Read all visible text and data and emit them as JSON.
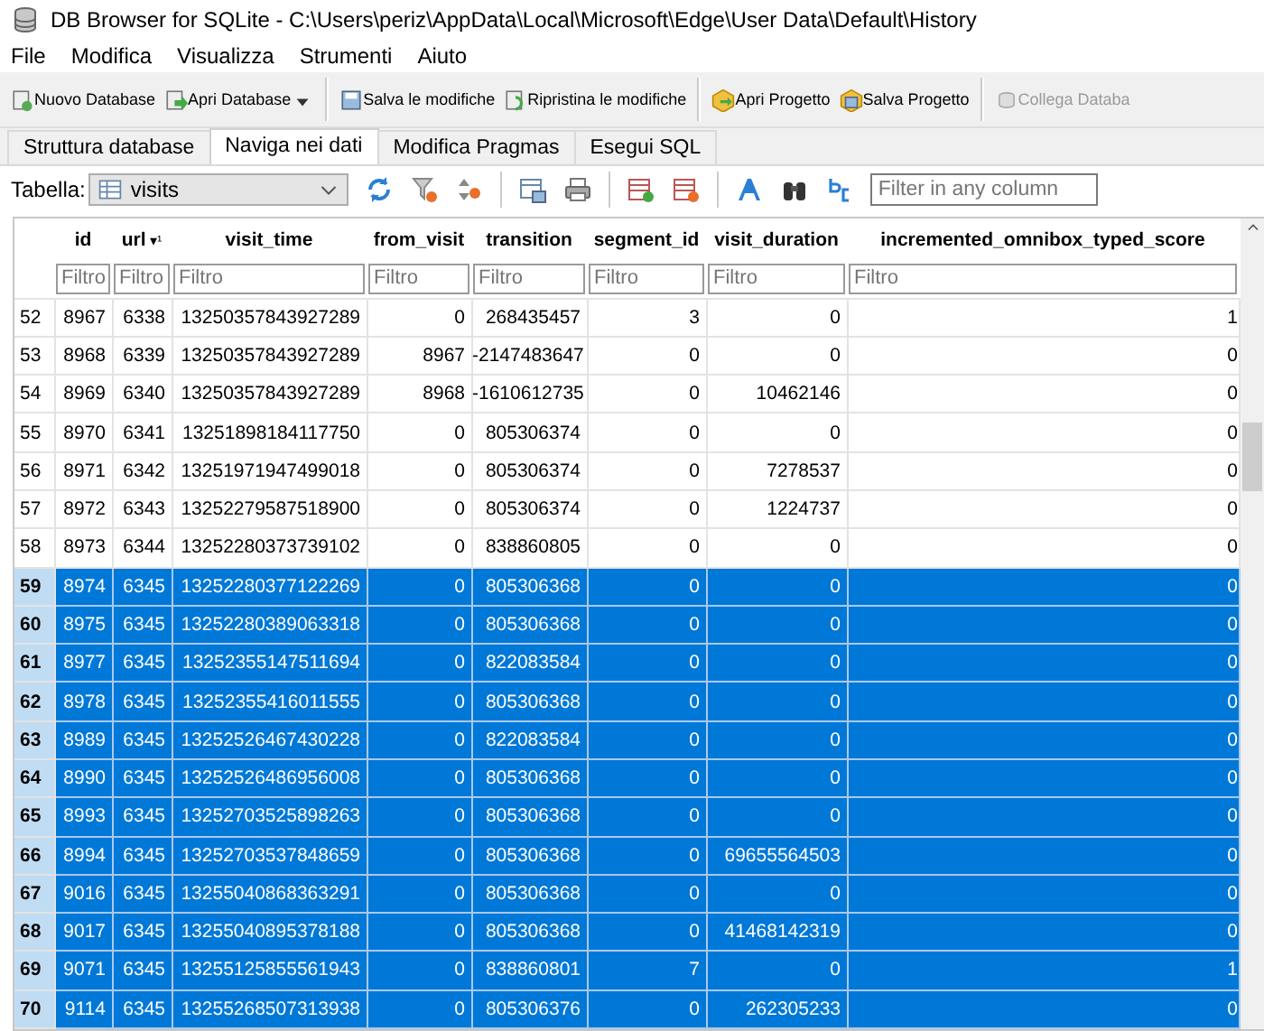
{
  "window": {
    "title": "DB Browser for SQLite - C:\\Users\\periz\\AppData\\Local\\Microsoft\\Edge\\User Data\\Default\\History"
  },
  "menu": [
    {
      "label": "File"
    },
    {
      "label": "Modifica"
    },
    {
      "label": "Visualizza"
    },
    {
      "label": "Strumenti"
    },
    {
      "label": "Aiuto"
    }
  ],
  "toolbar": [
    {
      "label": "Nuovo Database",
      "disabled": false
    },
    {
      "label": "Apri Database",
      "disabled": false
    },
    {
      "label": "Salva le modifiche",
      "disabled": false
    },
    {
      "label": "Ripristina le modifiche",
      "disabled": false
    },
    {
      "label": "Apri Progetto",
      "disabled": false
    },
    {
      "label": "Salva Progetto",
      "disabled": false
    },
    {
      "label": "Collega Databa",
      "disabled": true
    }
  ],
  "tabs": [
    {
      "label": "Struttura database",
      "selected": false
    },
    {
      "label": "Naviga nei dati",
      "selected": true
    },
    {
      "label": "Modifica Pragmas",
      "selected": false
    },
    {
      "label": "Esegui SQL",
      "selected": false
    }
  ],
  "table_picker": {
    "label": "Tabella:",
    "value": "visits"
  },
  "search": {
    "placeholder": "Filter in any column"
  },
  "table": {
    "columns": [
      {
        "name": "id",
        "filter_placeholder": "Filtro"
      },
      {
        "name": "url",
        "sort": "▾¹",
        "filter_placeholder": "Filtro"
      },
      {
        "name": "visit_time",
        "filter_placeholder": "Filtro"
      },
      {
        "name": "from_visit",
        "filter_placeholder": "Filtro"
      },
      {
        "name": "transition",
        "filter_placeholder": "Filtro"
      },
      {
        "name": "segment_id",
        "filter_placeholder": "Filtro"
      },
      {
        "name": "visit_duration",
        "filter_placeholder": "Filtro"
      },
      {
        "name": "incremented_omnibox_typed_score",
        "filter_placeholder": "Filtro"
      }
    ],
    "rows": [
      {
        "num": "52",
        "selected": false,
        "cells": [
          "8967",
          "6338",
          "13250357843927289",
          "0",
          "268435457",
          "3",
          "0",
          "1"
        ]
      },
      {
        "num": "53",
        "selected": false,
        "cells": [
          "8968",
          "6339",
          "13250357843927289",
          "8967",
          "-2147483647",
          "0",
          "0",
          "0"
        ]
      },
      {
        "num": "54",
        "selected": false,
        "cells": [
          "8969",
          "6340",
          "13250357843927289",
          "8968",
          "-1610612735",
          "0",
          "10462146",
          "0"
        ]
      },
      {
        "num": "55",
        "selected": false,
        "cells": [
          "8970",
          "6341",
          "13251898184117750",
          "0",
          "805306374",
          "0",
          "0",
          "0"
        ]
      },
      {
        "num": "56",
        "selected": false,
        "cells": [
          "8971",
          "6342",
          "13251971947499018",
          "0",
          "805306374",
          "0",
          "7278537",
          "0"
        ]
      },
      {
        "num": "57",
        "selected": false,
        "cells": [
          "8972",
          "6343",
          "13252279587518900",
          "0",
          "805306374",
          "0",
          "1224737",
          "0"
        ]
      },
      {
        "num": "58",
        "selected": false,
        "cells": [
          "8973",
          "6344",
          "13252280373739102",
          "0",
          "838860805",
          "0",
          "0",
          "0"
        ]
      },
      {
        "num": "59",
        "selected": true,
        "cells": [
          "8974",
          "6345",
          "13252280377122269",
          "0",
          "805306368",
          "0",
          "0",
          "0"
        ]
      },
      {
        "num": "60",
        "selected": true,
        "cells": [
          "8975",
          "6345",
          "13252280389063318",
          "0",
          "805306368",
          "0",
          "0",
          "0"
        ]
      },
      {
        "num": "61",
        "selected": true,
        "cells": [
          "8977",
          "6345",
          "13252355147511694",
          "0",
          "822083584",
          "0",
          "0",
          "0"
        ]
      },
      {
        "num": "62",
        "selected": true,
        "cells": [
          "8978",
          "6345",
          "13252355416011555",
          "0",
          "805306368",
          "0",
          "0",
          "0"
        ]
      },
      {
        "num": "63",
        "selected": true,
        "cells": [
          "8989",
          "6345",
          "13252526467430228",
          "0",
          "822083584",
          "0",
          "0",
          "0"
        ]
      },
      {
        "num": "64",
        "selected": true,
        "cells": [
          "8990",
          "6345",
          "13252526486956008",
          "0",
          "805306368",
          "0",
          "0",
          "0"
        ]
      },
      {
        "num": "65",
        "selected": true,
        "cells": [
          "8993",
          "6345",
          "13252703525898263",
          "0",
          "805306368",
          "0",
          "0",
          "0"
        ]
      },
      {
        "num": "66",
        "selected": true,
        "cells": [
          "8994",
          "6345",
          "13252703537848659",
          "0",
          "805306368",
          "0",
          "69655564503",
          "0"
        ]
      },
      {
        "num": "67",
        "selected": true,
        "cells": [
          "9016",
          "6345",
          "13255040868363291",
          "0",
          "805306368",
          "0",
          "0",
          "0"
        ]
      },
      {
        "num": "68",
        "selected": true,
        "cells": [
          "9017",
          "6345",
          "13255040895378188",
          "0",
          "805306368",
          "0",
          "41468142319",
          "0"
        ]
      },
      {
        "num": "69",
        "selected": true,
        "cells": [
          "9071",
          "6345",
          "13255125855561943",
          "0",
          "838860801",
          "7",
          "0",
          "1"
        ]
      },
      {
        "num": "70",
        "selected": true,
        "cells": [
          "9114",
          "6345",
          "13255268507313938",
          "0",
          "805306376",
          "0",
          "262305233",
          "0"
        ]
      }
    ]
  }
}
